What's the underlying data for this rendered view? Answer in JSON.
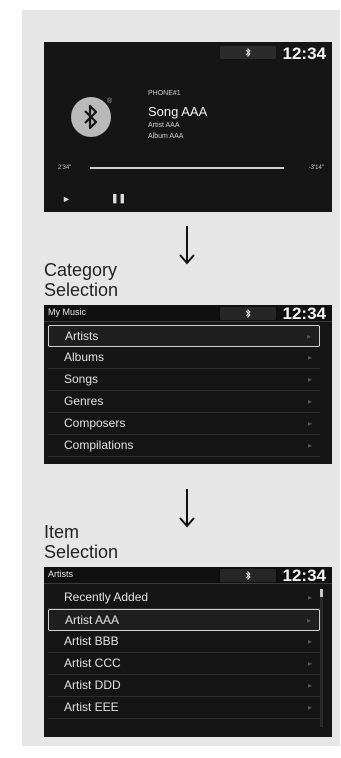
{
  "status": {
    "clock": "12:34",
    "bluetooth_icon": "bluetooth-icon"
  },
  "now_playing": {
    "source": "PHONE#1",
    "song": "Song AAA",
    "artist": "Artist AAA",
    "album": "Album AAA",
    "elapsed": "2'34\"",
    "remaining": "-3'14\"",
    "play_icon": "play-icon",
    "pause_icon": "pause-icon"
  },
  "step1": {
    "label_line1": "Category",
    "label_line2": "Selection"
  },
  "my_music": {
    "title": "My Music",
    "items": [
      {
        "label": "Artists",
        "selected": true
      },
      {
        "label": "Albums"
      },
      {
        "label": "Songs"
      },
      {
        "label": "Genres"
      },
      {
        "label": "Composers"
      },
      {
        "label": "Compilations"
      }
    ]
  },
  "step2": {
    "label_line1": "Item",
    "label_line2": "Selection"
  },
  "artists": {
    "title": "Artists",
    "items": [
      {
        "label": "Recently Added"
      },
      {
        "label": "Artist AAA",
        "selected": true
      },
      {
        "label": "Artist BBB"
      },
      {
        "label": "Artist CCC"
      },
      {
        "label": "Artist DDD"
      },
      {
        "label": "Artist EEE"
      }
    ]
  }
}
